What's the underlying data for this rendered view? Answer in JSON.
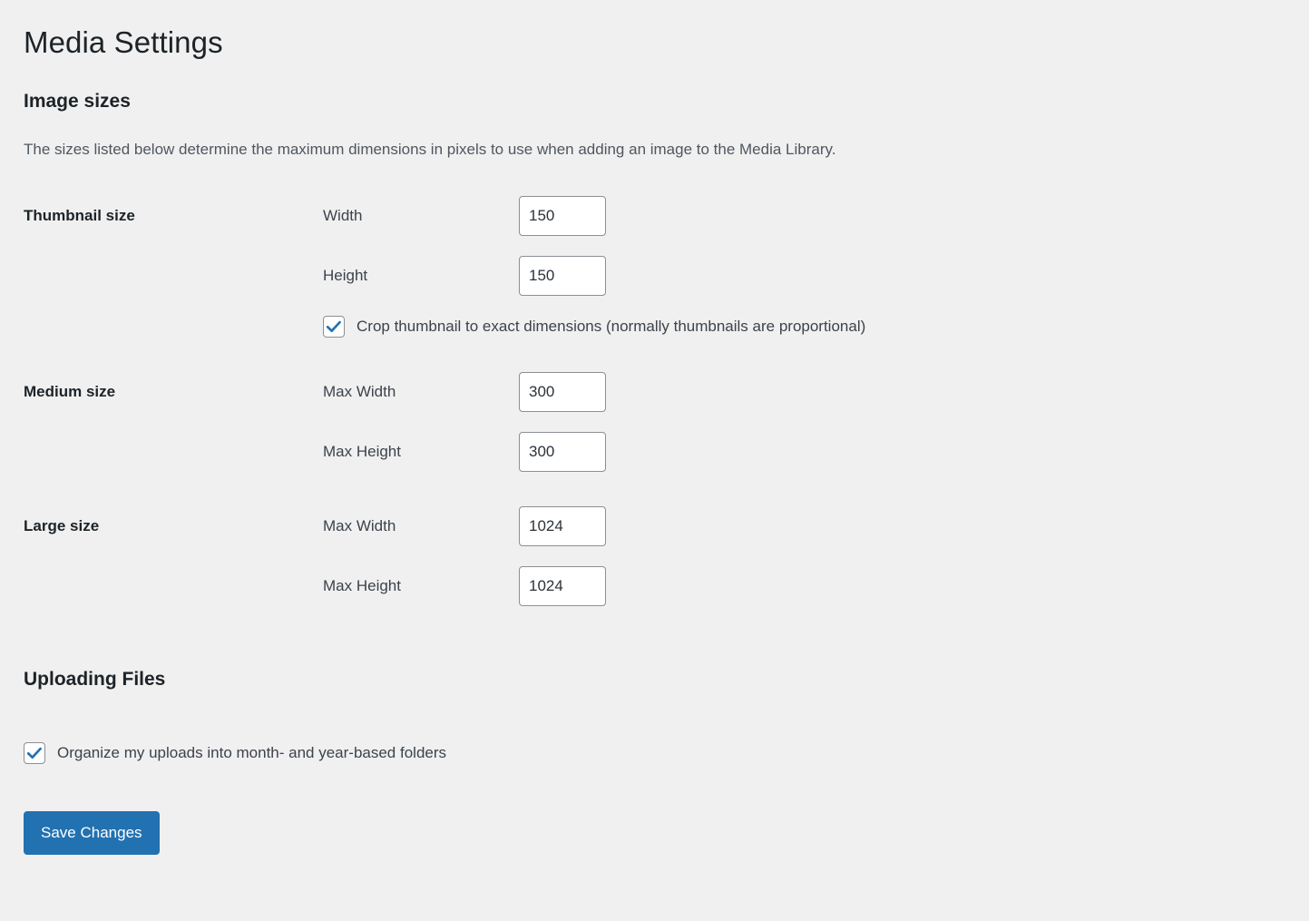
{
  "page": {
    "title": "Media Settings"
  },
  "image_sizes": {
    "heading": "Image sizes",
    "description": "The sizes listed below determine the maximum dimensions in pixels to use when adding an image to the Media Library.",
    "groups": [
      {
        "name": "Thumbnail size",
        "fields": [
          {
            "label": "Width",
            "value": "150"
          },
          {
            "label": "Height",
            "value": "150"
          }
        ],
        "checkbox": {
          "label": "Crop thumbnail to exact dimensions (normally thumbnails are proportional)",
          "checked": true
        }
      },
      {
        "name": "Medium size",
        "fields": [
          {
            "label": "Max Width",
            "value": "300"
          },
          {
            "label": "Max Height",
            "value": "300"
          }
        ]
      },
      {
        "name": "Large size",
        "fields": [
          {
            "label": "Max Width",
            "value": "1024"
          },
          {
            "label": "Max Height",
            "value": "1024"
          }
        ]
      }
    ]
  },
  "uploading_files": {
    "heading": "Uploading Files",
    "organize": {
      "label": "Organize my uploads into month- and year-based folders",
      "checked": true
    }
  },
  "actions": {
    "save_label": "Save Changes"
  },
  "colors": {
    "background": "#f0f0f1",
    "accent": "#2271b1",
    "heading_text": "#1d2327",
    "body_text": "#3c434a",
    "muted_text": "#50575e",
    "border": "#8c8f94",
    "checkmark": "#2271b1"
  }
}
